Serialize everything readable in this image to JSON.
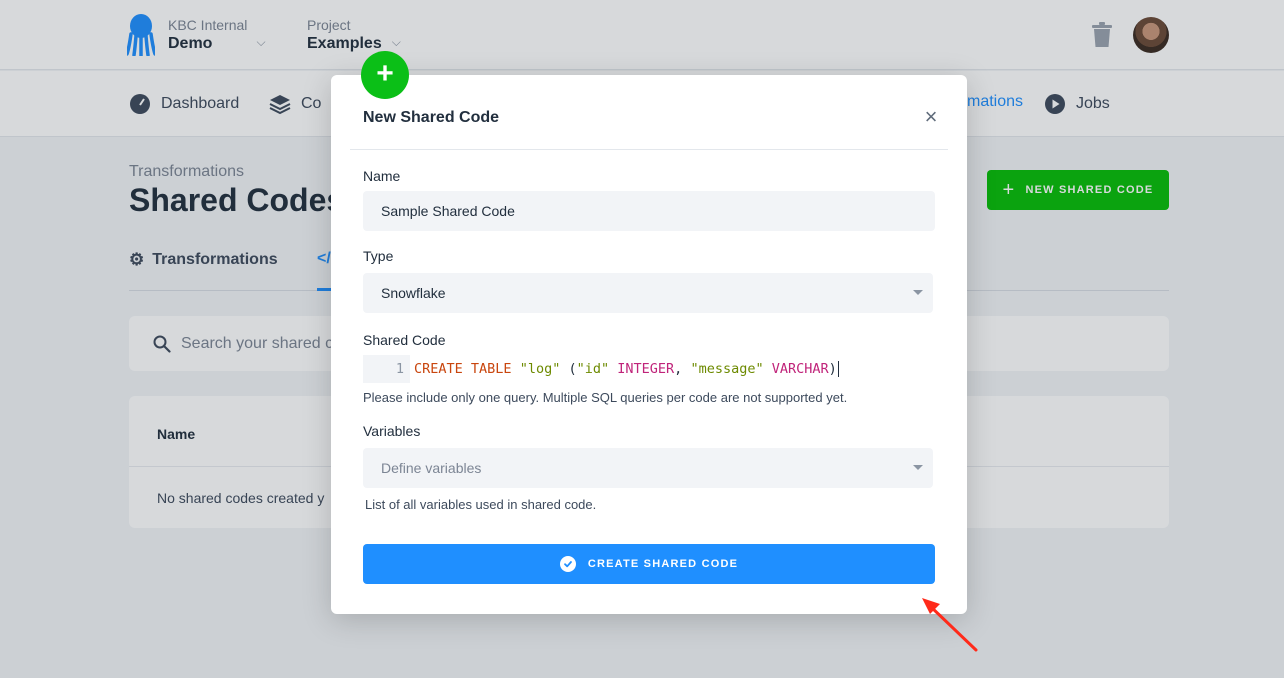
{
  "topbar": {
    "org": {
      "label": "KBC Internal",
      "value": "Demo"
    },
    "project": {
      "label": "Project",
      "value": "Examples"
    }
  },
  "nav": {
    "dashboard": "Dashboard",
    "components_partial": "Co",
    "transformations_partial": "mations",
    "jobs": "Jobs"
  },
  "page": {
    "breadcrumb": "Transformations",
    "title": "Shared Codes",
    "new_button": "NEW SHARED CODE",
    "tabs": {
      "transformations": "Transformations",
      "shared_codes_partial": "</"
    },
    "search_placeholder": "Search your shared c",
    "table": {
      "header_name": "Name",
      "empty_row": "No shared codes created y"
    }
  },
  "modal": {
    "title": "New Shared Code",
    "close": "×",
    "name_label": "Name",
    "name_value": "Sample Shared Code",
    "type_label": "Type",
    "type_value": "Snowflake",
    "code_label": "Shared Code",
    "code": {
      "line_number": "1",
      "kw1": "CREATE TABLE",
      "s1": "\"log\"",
      "p1": "(",
      "s2": "\"id\"",
      "t1": "INTEGER",
      "p2": ",",
      "s3": "\"message\"",
      "t2": "VARCHAR",
      "p3": ")"
    },
    "code_help": "Please include only one query. Multiple SQL queries per code are not supported yet.",
    "variables_label": "Variables",
    "variables_placeholder": "Define variables",
    "variables_help": "List of all variables used in shared code.",
    "submit": "CREATE SHARED CODE"
  },
  "colors": {
    "primary": "#1f8fff",
    "success": "#07be07",
    "arrow": "#ff2a1a"
  }
}
